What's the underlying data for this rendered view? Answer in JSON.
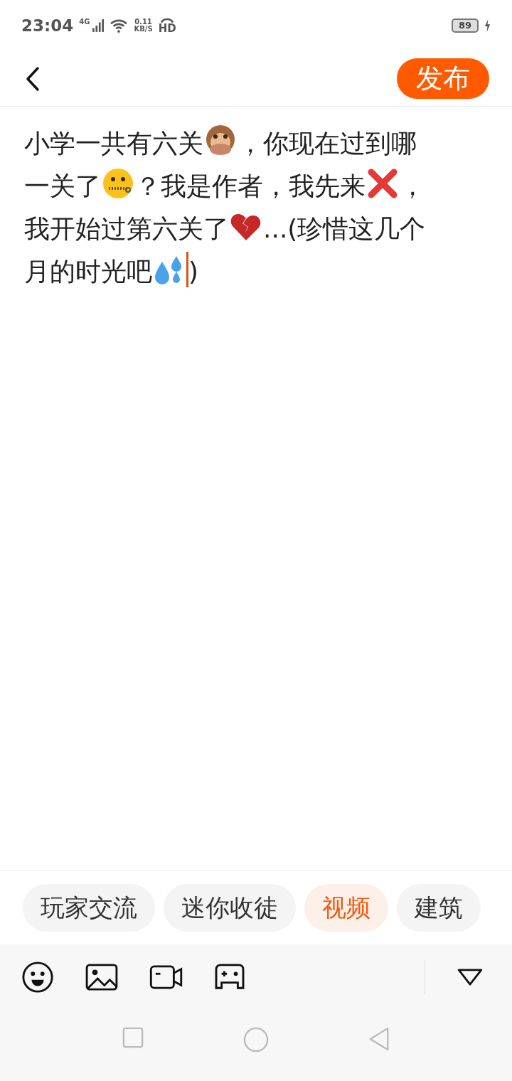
{
  "status_bar": {
    "time": "23:04",
    "network": "4G",
    "speed": "0.11",
    "speed_unit": "KB/S",
    "hd": "HD",
    "battery": "89",
    "charging": true
  },
  "header": {
    "publish_button": "发布"
  },
  "post": [
    [
      {
        "kind": "text",
        "text": "小学一共有六关"
      },
      {
        "kind": "monkey"
      },
      {
        "kind": "text",
        "text": "，你现在过到哪"
      }
    ],
    [
      {
        "kind": "text",
        "text": "一关了"
      },
      {
        "kind": "zipper"
      },
      {
        "kind": "text",
        "text": "？我是作者，我先来"
      },
      {
        "kind": "cross"
      },
      {
        "kind": "text",
        "text": "，"
      }
    ],
    [
      {
        "kind": "text",
        "text": "我开始过第六关了"
      },
      {
        "kind": "heartbreak"
      },
      {
        "kind": "text",
        "text": "...(珍惜这几个"
      }
    ],
    [
      {
        "kind": "text",
        "text": "月的时光吧"
      },
      {
        "kind": "sweat"
      },
      {
        "kind": "cursor"
      },
      {
        "kind": "text",
        "text": ")"
      }
    ]
  ],
  "topics": [
    {
      "label": "玩家交流",
      "selected": false
    },
    {
      "label": "迷你收徒",
      "selected": false
    },
    {
      "label": "视频",
      "selected": true
    },
    {
      "label": "建筑",
      "selected": false
    }
  ]
}
